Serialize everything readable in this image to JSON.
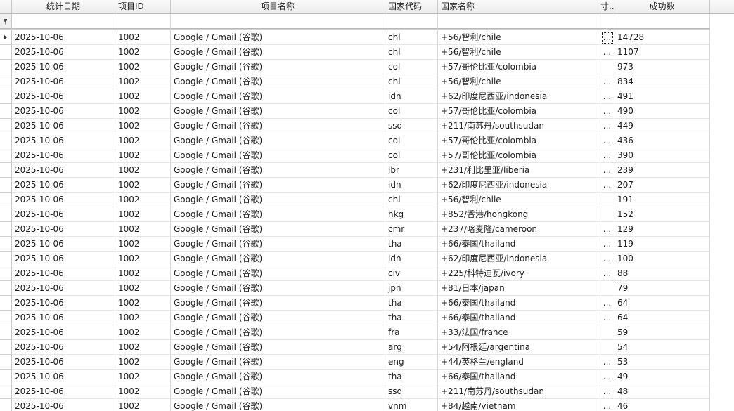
{
  "grid": {
    "headers": {
      "stat_date": "统计日期",
      "project_id": "项目ID",
      "project_name": "项目名称",
      "country_code": "国家代码",
      "country_name": "国家名称",
      "truncated": "寸..",
      "success_count": "成功数"
    },
    "filter_icon": "filter-pin-icon",
    "selected_row_index": 0,
    "rows": [
      {
        "date": "2025-10-06",
        "pid": "1002",
        "pname": "Google / Gmail (谷歌)",
        "cc": "chl",
        "cn": "+56/智利/chile",
        "x": "...",
        "ok": "14728"
      },
      {
        "date": "2025-10-06",
        "pid": "1002",
        "pname": "Google / Gmail (谷歌)",
        "cc": "chl",
        "cn": "+56/智利/chile",
        "x": "...",
        "ok": "1107"
      },
      {
        "date": "2025-10-06",
        "pid": "1002",
        "pname": "Google / Gmail (谷歌)",
        "cc": "col",
        "cn": "+57/哥伦比亚/colombia",
        "x": "",
        "ok": "973"
      },
      {
        "date": "2025-10-06",
        "pid": "1002",
        "pname": "Google / Gmail (谷歌)",
        "cc": "chl",
        "cn": "+56/智利/chile",
        "x": "...",
        "ok": "834"
      },
      {
        "date": "2025-10-06",
        "pid": "1002",
        "pname": "Google / Gmail (谷歌)",
        "cc": "idn",
        "cn": "+62/印度尼西亚/indonesia",
        "x": "...",
        "ok": "491"
      },
      {
        "date": "2025-10-06",
        "pid": "1002",
        "pname": "Google / Gmail (谷歌)",
        "cc": "col",
        "cn": "+57/哥伦比亚/colombia",
        "x": "...",
        "ok": "490"
      },
      {
        "date": "2025-10-06",
        "pid": "1002",
        "pname": "Google / Gmail (谷歌)",
        "cc": "ssd",
        "cn": "+211/南苏丹/southsudan",
        "x": "...",
        "ok": "449"
      },
      {
        "date": "2025-10-06",
        "pid": "1002",
        "pname": "Google / Gmail (谷歌)",
        "cc": "col",
        "cn": "+57/哥伦比亚/colombia",
        "x": "...",
        "ok": "436"
      },
      {
        "date": "2025-10-06",
        "pid": "1002",
        "pname": "Google / Gmail (谷歌)",
        "cc": "col",
        "cn": "+57/哥伦比亚/colombia",
        "x": "...",
        "ok": "390"
      },
      {
        "date": "2025-10-06",
        "pid": "1002",
        "pname": "Google / Gmail (谷歌)",
        "cc": "lbr",
        "cn": "+231/利比里亚/liberia",
        "x": "...",
        "ok": "239"
      },
      {
        "date": "2025-10-06",
        "pid": "1002",
        "pname": "Google / Gmail (谷歌)",
        "cc": "idn",
        "cn": "+62/印度尼西亚/indonesia",
        "x": "...",
        "ok": "207"
      },
      {
        "date": "2025-10-06",
        "pid": "1002",
        "pname": "Google / Gmail (谷歌)",
        "cc": "chl",
        "cn": "+56/智利/chile",
        "x": "",
        "ok": "191"
      },
      {
        "date": "2025-10-06",
        "pid": "1002",
        "pname": "Google / Gmail (谷歌)",
        "cc": "hkg",
        "cn": "+852/香港/hongkong",
        "x": "",
        "ok": "152"
      },
      {
        "date": "2025-10-06",
        "pid": "1002",
        "pname": "Google / Gmail (谷歌)",
        "cc": "cmr",
        "cn": "+237/喀麦隆/cameroon",
        "x": "...",
        "ok": "129"
      },
      {
        "date": "2025-10-06",
        "pid": "1002",
        "pname": "Google / Gmail (谷歌)",
        "cc": "tha",
        "cn": "+66/泰国/thailand",
        "x": "...",
        "ok": "119"
      },
      {
        "date": "2025-10-06",
        "pid": "1002",
        "pname": "Google / Gmail (谷歌)",
        "cc": "idn",
        "cn": "+62/印度尼西亚/indonesia",
        "x": "...",
        "ok": "100"
      },
      {
        "date": "2025-10-06",
        "pid": "1002",
        "pname": "Google / Gmail (谷歌)",
        "cc": "civ",
        "cn": "+225/科特迪瓦/ivory",
        "x": "...",
        "ok": "88"
      },
      {
        "date": "2025-10-06",
        "pid": "1002",
        "pname": "Google / Gmail (谷歌)",
        "cc": "jpn",
        "cn": "+81/日本/japan",
        "x": "",
        "ok": "79"
      },
      {
        "date": "2025-10-06",
        "pid": "1002",
        "pname": "Google / Gmail (谷歌)",
        "cc": "tha",
        "cn": "+66/泰国/thailand",
        "x": "...",
        "ok": "64"
      },
      {
        "date": "2025-10-06",
        "pid": "1002",
        "pname": "Google / Gmail (谷歌)",
        "cc": "tha",
        "cn": "+66/泰国/thailand",
        "x": "...",
        "ok": "64"
      },
      {
        "date": "2025-10-06",
        "pid": "1002",
        "pname": "Google / Gmail (谷歌)",
        "cc": "fra",
        "cn": "+33/法国/france",
        "x": "",
        "ok": "59"
      },
      {
        "date": "2025-10-06",
        "pid": "1002",
        "pname": "Google / Gmail (谷歌)",
        "cc": "arg",
        "cn": "+54/阿根廷/argentina",
        "x": "",
        "ok": "54"
      },
      {
        "date": "2025-10-06",
        "pid": "1002",
        "pname": "Google / Gmail (谷歌)",
        "cc": "eng",
        "cn": "+44/英格兰/england",
        "x": "...",
        "ok": "53"
      },
      {
        "date": "2025-10-06",
        "pid": "1002",
        "pname": "Google / Gmail (谷歌)",
        "cc": "tha",
        "cn": "+66/泰国/thailand",
        "x": "...",
        "ok": "49"
      },
      {
        "date": "2025-10-06",
        "pid": "1002",
        "pname": "Google / Gmail (谷歌)",
        "cc": "ssd",
        "cn": "+211/南苏丹/southsudan",
        "x": "...",
        "ok": "48"
      },
      {
        "date": "2025-10-06",
        "pid": "1002",
        "pname": "Google / Gmail (谷歌)",
        "cc": "vnm",
        "cn": "+84/越南/vietnam",
        "x": "...",
        "ok": "46"
      }
    ]
  }
}
